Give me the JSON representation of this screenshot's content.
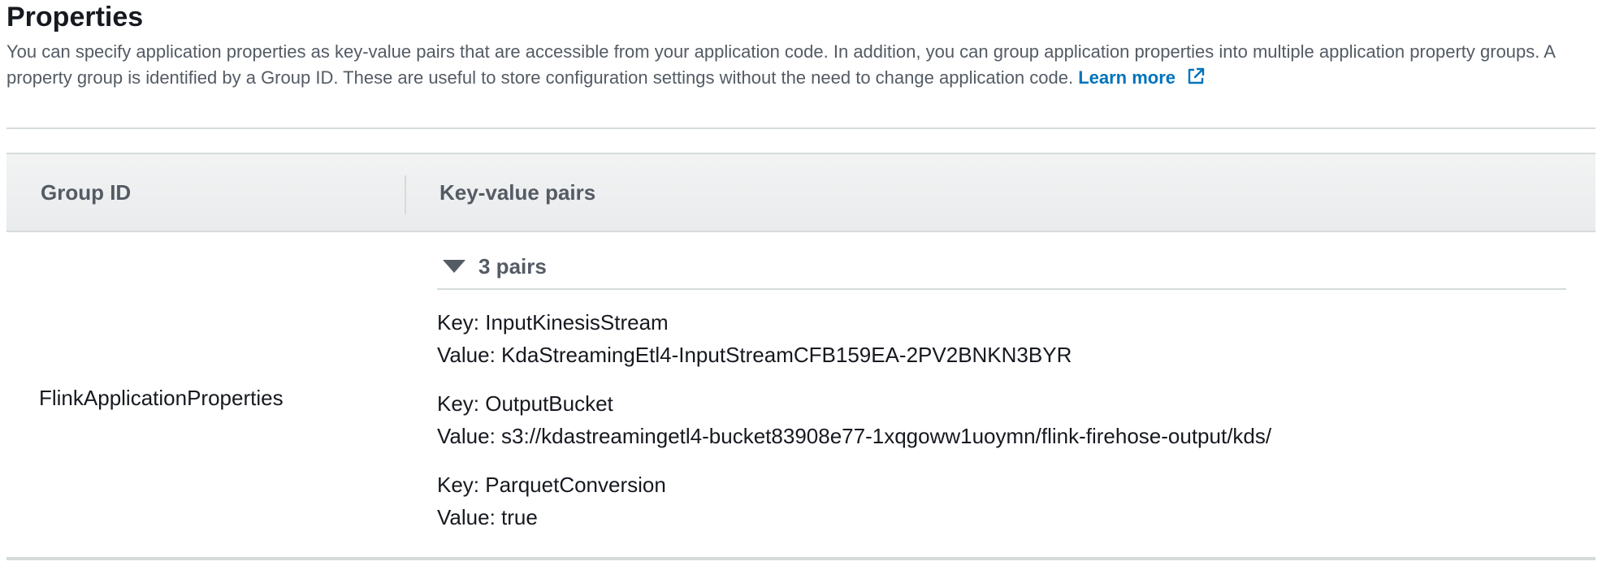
{
  "section": {
    "title": "Properties",
    "description": "You can specify application properties as key-value pairs that are accessible from your application code. In addition, you can group application properties into multiple application property groups. A property group is identified by a Group ID. These are useful to store configuration settings without the need to change application code.",
    "learn_more_label": "Learn more",
    "learn_more_icon": "external-link-icon"
  },
  "table": {
    "columns": [
      "Group ID",
      "Key-value pairs"
    ],
    "rows": [
      {
        "group_id": "FlinkApplicationProperties",
        "pairs_toggle_label": "3 pairs",
        "pairs_expanded": true,
        "pairs": [
          {
            "key": "Key: InputKinesisStream",
            "value": "Value: KdaStreamingEtl4-InputStreamCFB159EA-2PV2BNKN3BYR"
          },
          {
            "key": "Key: OutputBucket",
            "value": "Value: s3://kdastreamingetl4-bucket83908e77-1xqgoww1uoymn/flink-firehose-output/kds/"
          },
          {
            "key": "Key: ParquetConversion",
            "value": "Value: true"
          }
        ]
      }
    ]
  },
  "colors": {
    "link": "#0073bb",
    "text": "#16191f",
    "muted": "#545b64",
    "border": "#d5dbdb",
    "header_bg": "#f2f3f3"
  }
}
